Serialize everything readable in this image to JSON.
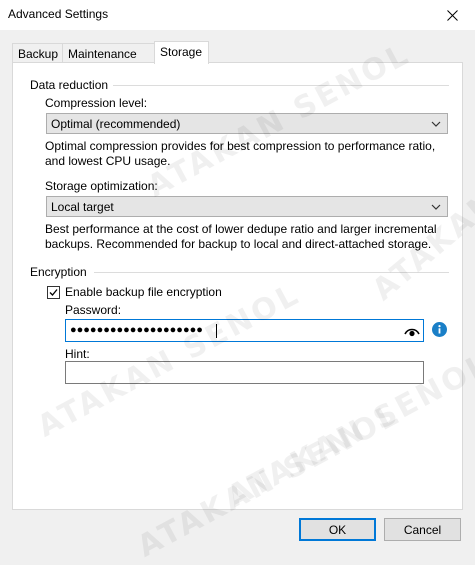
{
  "window": {
    "title": "Advanced Settings"
  },
  "tabs": [
    {
      "label": "Backup",
      "active": false
    },
    {
      "label": "Maintenance",
      "active": false
    },
    {
      "label": "Storage",
      "active": true
    }
  ],
  "data_reduction": {
    "group_label": "Data reduction",
    "compression_label": "Compression level:",
    "compression_value": "Optimal (recommended)",
    "compression_description": "Optimal compression provides for best compression to performance ratio, and lowest CPU usage.",
    "storage_label": "Storage optimization:",
    "storage_value": "Local target",
    "storage_description": "Best performance at the cost of lower dedupe ratio and larger incremental backups. Recommended for backup to local and direct-attached storage."
  },
  "encryption": {
    "group_label": "Encryption",
    "enable_label": "Enable backup file encryption",
    "enable_checked": true,
    "password_label": "Password:",
    "password_value": "●●●●●●●●●●●●●●●●●●●●",
    "hint_label": "Hint:",
    "hint_value": ""
  },
  "watermark": {
    "text": "ATAKAN SENOL"
  },
  "buttons": {
    "ok": "OK",
    "cancel": "Cancel"
  },
  "colors": {
    "accent": "#0078d7",
    "info": "#1a7fc7"
  }
}
